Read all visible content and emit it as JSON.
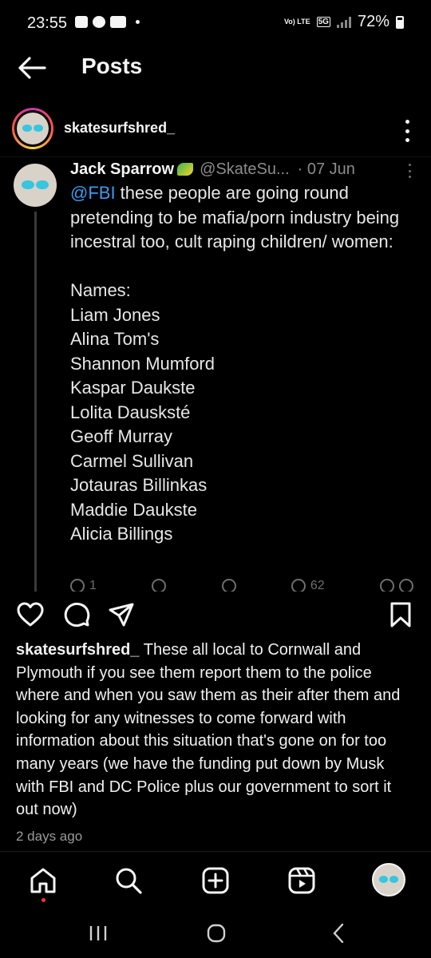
{
  "status_bar": {
    "time": "23:55",
    "network_label": "Vo) LTE",
    "network_5g": "5G",
    "battery": "72%",
    "icons": [
      "gallery-icon",
      "facebook-icon",
      "youtube-icon"
    ]
  },
  "header": {
    "title": "Posts",
    "back_icon": "arrow-left-icon"
  },
  "post": {
    "username": "skatesurfshred_",
    "options_icon": "more-vertical-icon"
  },
  "tweet": {
    "display_name": "Jack Sparrow",
    "handle": "@SkateSu...",
    "date": "· 07 Jun",
    "mention": "@FBI",
    "text": " these people are going round pretending to be mafia/porn industry being incestral too, cult raping children/ women:",
    "names_header": "Names:",
    "names": [
      "Liam Jones",
      "Alina Tom's",
      "Shannon Mumford",
      "Kaspar Daukste",
      "Lolita Dausksté",
      "Geoff Murray",
      "Carmel  Sullivan",
      "Jotauras Billinkas",
      "Maddie Daukste",
      "Alicia Billings"
    ],
    "reply_count": "1",
    "views_count": "62"
  },
  "actions": {
    "like_icon": "heart-icon",
    "comment_icon": "comment-icon",
    "share_icon": "send-icon",
    "save_icon": "bookmark-icon"
  },
  "caption": {
    "username": "skatesurfshred_",
    "text": " These all local to Cornwall and Plymouth if you see them report them to the police where and when you saw them as their after them and looking for any witnesses to come forward with information about this situation that's gone on for too many years (we have the funding put down by Musk with FBI and DC Police plus our government to sort it out now)",
    "time_ago": "2 days ago"
  },
  "bottom_nav": {
    "items": [
      "home-icon",
      "search-icon",
      "create-icon",
      "reels-icon",
      "profile-avatar"
    ]
  },
  "colors": {
    "background": "#000000",
    "mention": "#3b9cf0",
    "muted": "#8b8b8b",
    "notification_dot": "#ff3040"
  }
}
